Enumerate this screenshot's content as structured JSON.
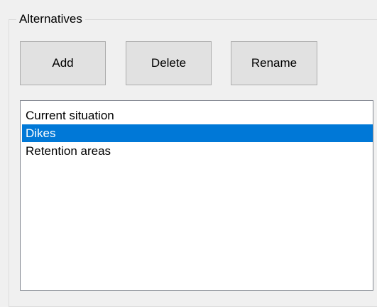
{
  "alternatives_group": {
    "title": "Alternatives",
    "buttons": {
      "add_label": "Add",
      "delete_label": "Delete",
      "rename_label": "Rename"
    },
    "list": {
      "items": [
        {
          "label": "Current situation",
          "selected": false
        },
        {
          "label": "Dikes",
          "selected": true
        },
        {
          "label": "Retention areas",
          "selected": false
        }
      ],
      "selected_index": 1
    }
  },
  "colors": {
    "background": "#f0f0f0",
    "button_face": "#e1e1e1",
    "button_border": "#adadad",
    "selection_highlight": "#0078d7",
    "selection_text": "#ffffff",
    "list_background": "#ffffff",
    "list_border": "#828790"
  }
}
